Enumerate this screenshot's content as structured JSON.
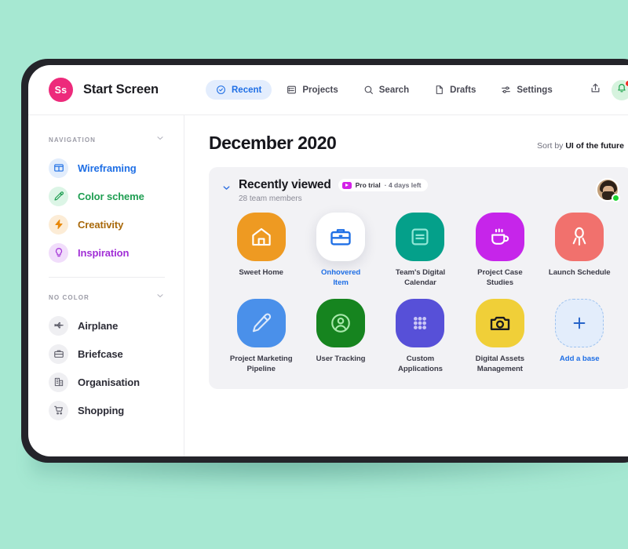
{
  "background_color": "#a6e8d2",
  "brand": {
    "badge_text": "Ss",
    "badge_color": "#ed2a7b",
    "title": "Start Screen"
  },
  "tabs": [
    {
      "label": "Recent",
      "icon": "clock-check-icon",
      "active": true
    },
    {
      "label": "Projects",
      "icon": "projects-icon",
      "active": false
    },
    {
      "label": "Search",
      "icon": "search-icon",
      "active": false
    },
    {
      "label": "Drafts",
      "icon": "document-icon",
      "active": false
    },
    {
      "label": "Settings",
      "icon": "sliders-icon",
      "active": false
    }
  ],
  "topbar_actions": {
    "share_icon": "share-upload-icon",
    "bell_icon": "bell-icon",
    "bell_badge_color": "#ee3124",
    "bell_bg_color": "#d6f3de"
  },
  "sidebar": {
    "sections": [
      {
        "title": "NAVIGATION",
        "items": [
          {
            "label": "Wireframing",
            "icon": "wireframe-icon",
            "color": "#1f6fe5",
            "bg": "#e2edfc"
          },
          {
            "label": "Color scheme",
            "icon": "eyedropper-icon",
            "color": "#1f9e52",
            "bg": "#dcf5e6"
          },
          {
            "label": "Creativity",
            "icon": "lightning-icon",
            "color": "#e8890c",
            "bg": "#fcecd6"
          },
          {
            "label": "Inspiration",
            "icon": "lightbulb-icon",
            "color": "#a12ed6",
            "bg": "#f1ddfb"
          }
        ]
      },
      {
        "title": "NO COLOR",
        "items": [
          {
            "label": "Airplane",
            "icon": "airplane-icon",
            "color": "#5c5c68",
            "bg": "#efeff2"
          },
          {
            "label": "Briefcase",
            "icon": "briefcase-icon",
            "color": "#5c5c68",
            "bg": "#efeff2"
          },
          {
            "label": "Organisation",
            "icon": "building-icon",
            "color": "#5c5c68",
            "bg": "#efeff2"
          },
          {
            "label": "Shopping",
            "icon": "cart-icon",
            "color": "#5c5c68",
            "bg": "#efeff2"
          }
        ]
      }
    ]
  },
  "main": {
    "page_title": "December 2020",
    "sort_prefix": "Sort by ",
    "sort_value": "UI of the future"
  },
  "card": {
    "title": "Recently viewed",
    "subtitle": "28 team members",
    "badge_label": "Pro trial",
    "badge_days": "· 4 days left",
    "collapse_icon": "chevron-down-icon",
    "avatar_name": "avatar",
    "avatar_status": "online"
  },
  "tiles": [
    [
      {
        "label": "Sweet Home",
        "icon": "home-icon",
        "bg": "#ee9a22",
        "state": "normal"
      },
      {
        "label": "Onhovered\nItem",
        "icon": "briefcase-icon",
        "bg": "#ffffff",
        "state": "hovered"
      },
      {
        "label": "Team's Digital\nCalendar",
        "icon": "calendar-icon",
        "bg": "#04a08a",
        "state": "normal"
      },
      {
        "label": "Project Case\nStudies",
        "icon": "coffee-cup-icon",
        "bg": "#c625ea",
        "state": "normal"
      },
      {
        "label": "Launch Schedule",
        "icon": "rocket-icon",
        "bg": "#f1716d",
        "state": "normal"
      }
    ],
    [
      {
        "label": "Project Marketing\nPipeline",
        "icon": "pencil-icon",
        "bg": "#4a90ea",
        "state": "normal"
      },
      {
        "label": "User Tracking",
        "icon": "user-icon",
        "bg": "#16841f",
        "state": "normal"
      },
      {
        "label": "Custom\nApplications",
        "icon": "grid-dots-icon",
        "bg": "#5750d8",
        "state": "normal"
      },
      {
        "label": "Digital Assets\nManagement",
        "icon": "camera-icon",
        "bg": "#f0cf38",
        "state": "normal"
      },
      {
        "label": "Add a base",
        "icon": "plus-icon",
        "bg": "#e3edfb",
        "state": "addbase"
      }
    ]
  ]
}
